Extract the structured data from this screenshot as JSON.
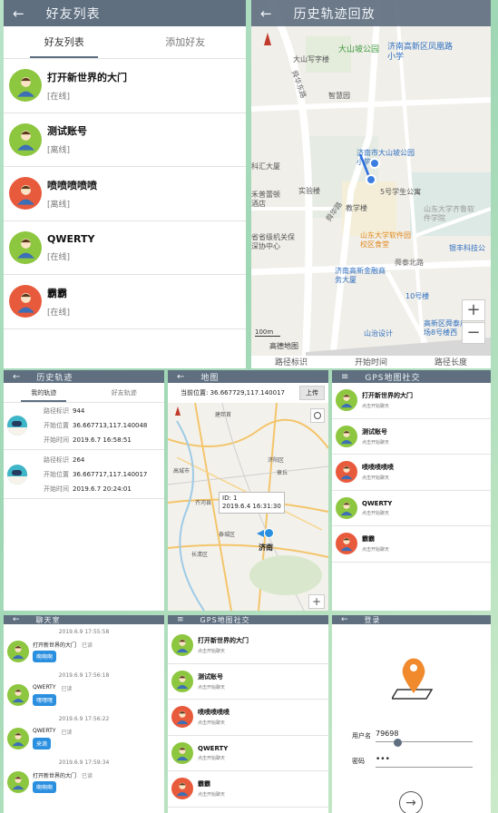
{
  "friends_panel": {
    "header": {
      "title": "好友列表",
      "back": "←"
    },
    "tabs": [
      "好友列表",
      "添加好友"
    ],
    "friends": [
      {
        "name": "打开新世界的大门",
        "status": "[在线]",
        "color": "#8dc63f"
      },
      {
        "name": "测试账号",
        "status": "[离线]",
        "color": "#8dc63f"
      },
      {
        "name": "喷喷喷喷喷",
        "status": "[离线]",
        "color": "#e85a3c"
      },
      {
        "name": "QWERTY",
        "status": "[在线]",
        "color": "#8dc63f"
      },
      {
        "name": "霸霸",
        "status": "[在线]",
        "color": "#e85a3c"
      }
    ]
  },
  "history_map_panel": {
    "header": {
      "title": "历史轨迹回放",
      "back": "←"
    },
    "map_labels": {
      "park": "大山坡公园",
      "school": "济南高新区凤凰路小学",
      "dashan": "大山写字楼",
      "road1": "舜华东路",
      "wisdom": "智慧园",
      "huida": "科汇大厦",
      "xiaozhu": "济南市大山坡公园小筑",
      "shiyan": "实验楼",
      "dorm": "5号学生公寓",
      "wenhe": "禾普蕾顿酒店",
      "teach": "教学楼",
      "road2": "舜华路",
      "campus": "山东大学齐鲁软件学院",
      "canteen": "山东大学软件园校区食堂",
      "gov": "省省级机关保深协中心",
      "bank": "银丰科技公",
      "road3": "舜泰北路",
      "jinrong": "济南高新金融商务大厦",
      "bldg10": "10号楼",
      "design": "山治设计",
      "gaoxin": "高新区舜泰广场8号楼西",
      "scale": "100m",
      "brand": "高德地图"
    },
    "bottom_labels": [
      "路径标识",
      "开始时间",
      "路径长度"
    ],
    "zoom_in": "+",
    "zoom_out": "−"
  },
  "track_panel": {
    "header": {
      "title": "历史轨迹",
      "back": "←"
    },
    "tabs": [
      "我的轨迹",
      "好友轨迹"
    ],
    "tracks": [
      {
        "id_label": "路径标识",
        "id": "944",
        "pos_label": "开始位置",
        "pos": "36.667713,117.140048",
        "time_label": "开始时间",
        "time": "2019.6.7 16:58:51"
      },
      {
        "id_label": "路径标识",
        "id": "264",
        "pos_label": "开始位置",
        "pos": "36.667717,117.140017",
        "time_label": "开始时间",
        "time": "2019.6.7 20:24:01"
      }
    ]
  },
  "map_panel": {
    "header": {
      "title": "地图",
      "back": "←"
    },
    "position_label": "当前位置: 36.667729,117.140017",
    "upload": "上传",
    "popup_id": "ID: 1",
    "popup_time": "2019.6.4 16:31:30",
    "city": "济南",
    "towns": [
      "建邦首",
      "高城市",
      "齐河县",
      "济阳区",
      "章丘",
      "泰城区",
      "长清区"
    ],
    "zoom_in": "+"
  },
  "gps_social_panel": {
    "header": {
      "title": "GPS地图社交",
      "menu": "≡"
    },
    "friends": [
      {
        "name": "打开新世界的大门",
        "sub": "点击开始聊天",
        "color": "#8dc63f"
      },
      {
        "name": "测试账号",
        "sub": "点击开始聊天",
        "color": "#8dc63f"
      },
      {
        "name": "喷喷喷喷喷",
        "sub": "点击开始聊天",
        "color": "#e85a3c"
      },
      {
        "name": "QWERTY",
        "sub": "点击开始聊天",
        "color": "#8dc63f"
      },
      {
        "name": "霸霸",
        "sub": "点击开始聊天",
        "color": "#e85a3c"
      }
    ]
  },
  "chat_panel": {
    "header": {
      "title": "聊天室",
      "back": "←"
    },
    "messages": [
      {
        "time": "2019.6.9 17:55:58",
        "name": "打开新世界的大门",
        "read": "已读",
        "text": "啊啊啊",
        "color": "#8dc63f"
      },
      {
        "time": "2019.6.9 17:56:18",
        "name": "QWERTY",
        "read": "已读",
        "text": "嘿嘿嘿",
        "color": "#8dc63f"
      },
      {
        "time": "2019.6.9 17:56:22",
        "name": "QWERTY",
        "read": "已读",
        "text": "来滴",
        "color": "#8dc63f"
      },
      {
        "time": "2019.6.9 17:59:34",
        "name": "打开新世界的大门",
        "read": "已读",
        "text": "啊啊啊",
        "color": "#8dc63f"
      }
    ]
  },
  "gps_social_panel_2": {
    "header": {
      "title": "GPS地图社交",
      "menu": "≡"
    },
    "friends": [
      {
        "name": "打开新世界的大门",
        "sub": "点击开始聊天",
        "color": "#8dc63f"
      },
      {
        "name": "测试账号",
        "sub": "点击开始聊天",
        "color": "#8dc63f"
      },
      {
        "name": "喷喷喷喷喷",
        "sub": "点击开始聊天",
        "color": "#e85a3c"
      },
      {
        "name": "QWERTY",
        "sub": "点击开始聊天",
        "color": "#8dc63f"
      },
      {
        "name": "霸霸",
        "sub": "点击开始聊天",
        "color": "#e85a3c"
      }
    ]
  },
  "login_panel": {
    "header": {
      "title": "登录",
      "back": "←"
    },
    "username_label": "用户名",
    "username_value": "79698",
    "password_label": "密码",
    "password_value": "•••",
    "submit_icon": "arrow-right-circle-icon"
  },
  "colors": {
    "header": "#5f6f80",
    "accent_blue": "#2b8fe0",
    "online_green": "#8dc63f",
    "avatar_red": "#e85a3c"
  }
}
